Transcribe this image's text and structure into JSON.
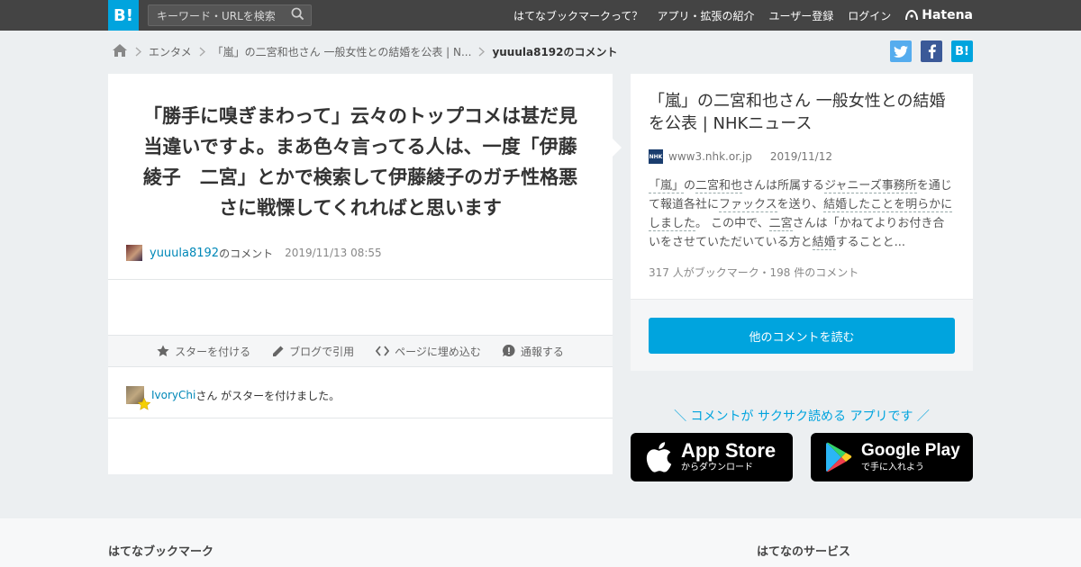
{
  "header": {
    "logo_text": "B!",
    "search_placeholder": "キーワード・URLを検索",
    "nav": [
      "はてなブックマークって？",
      "アプリ・拡張の紹介",
      "ユーザー登録",
      "ログイン"
    ],
    "brand": "Hatena"
  },
  "breadcrumb": {
    "items": [
      "エンタメ",
      "「嵐」の二宮和也さん 一般女性との結婚を公表 | N..."
    ],
    "current": "yuuula8192のコメント"
  },
  "share": {
    "twitter_icon": "twitter-icon",
    "facebook_icon": "facebook-icon",
    "hatebu_label": "B!"
  },
  "comment": {
    "text": "「勝手に嗅ぎまわって」云々のトップコメは甚だ見当違いですよ。まあ色々言ってる人は、一度「伊藤綾子　二宮」とかで検索して伊藤綾子のガチ性格悪さに戦慄してくれればと思います",
    "user": "yuuula8192",
    "suffix": "のコメント",
    "date": "2019/11/13 08:55"
  },
  "actions": [
    {
      "label": "スターを付ける",
      "icon": "star-icon"
    },
    {
      "label": "ブログで引用",
      "icon": "pencil-icon"
    },
    {
      "label": "ページに埋め込む",
      "icon": "code-icon"
    },
    {
      "label": "通報する",
      "icon": "report-icon"
    }
  ],
  "star": {
    "user": "IvoryChi",
    "text": "さん がスターを付けました。"
  },
  "entry": {
    "title": "「嵐」の二宮和也さん 一般女性との結婚を公表 | NHKニュース",
    "favicon_text": "NHK",
    "domain": "www3.nhk.or.jp",
    "date": "2019/11/12",
    "summary": {
      "kw1": "「嵐」",
      "t1": "の",
      "kw2": "二宮和也",
      "t2": "さんは所属する",
      "kw3": "ジャニーズ事務所",
      "t3": "を通じて報道各社に",
      "kw4": "ファックス",
      "t4": "を送り、",
      "kw5": "結婚したことを明らかにしました",
      "t5": "。 この中で、",
      "kw6": "二宮",
      "t6": "さんは「かねてよりお付き合いをさせていただいている方と",
      "kw7": "結婚",
      "t7": "することと..."
    },
    "stats": "317 人がブックマーク・198 件のコメント",
    "read_button": "他のコメントを読む"
  },
  "app_promo": {
    "text": "＼ コメントが サクサク読める アプリです ／",
    "app_store_main": "App Store",
    "app_store_sub": "からダウンロード",
    "google_play_main": "Google Play",
    "google_play_sub": "で手に入れよう"
  },
  "footer": {
    "left_title": "はてなブックマーク",
    "right_title": "はてなのサービス"
  },
  "colors": {
    "accent": "#00a4de",
    "topbar": "#444444",
    "twitter": "#55acee",
    "facebook": "#3b5998"
  }
}
